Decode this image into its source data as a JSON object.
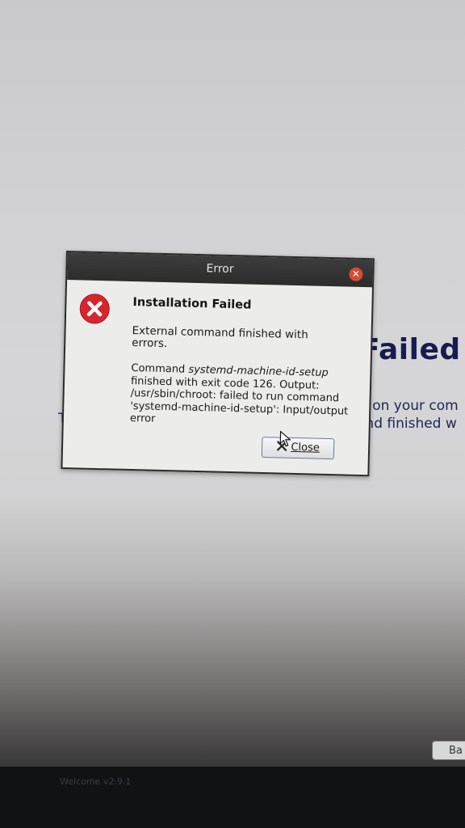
{
  "background": {
    "heading": "Failed",
    "line1": "d on your com",
    "line2": "and finished w",
    "left_fragment": "Th",
    "back_button_label": "Ba",
    "taskbar_label": "Welcome v2.9.1"
  },
  "dialog": {
    "window_title": "Error",
    "title": "Installation Failed",
    "message": "External command finished with errors.",
    "detail_prefix": "Command ",
    "detail_command": "systemd-machine-id-setup",
    "detail_suffix": " finished with exit code 126. Output: /usr/sbin/chroot: failed to run command 'systemd-machine-id-setup': Input/output error",
    "close_button_label": "Close",
    "icons": {
      "error": "error-icon",
      "window_close": "close-icon",
      "button": "close-icon"
    }
  },
  "colors": {
    "error_red": "#d7252e",
    "titlebar": "#333333",
    "heading_navy": "#161c4d"
  }
}
